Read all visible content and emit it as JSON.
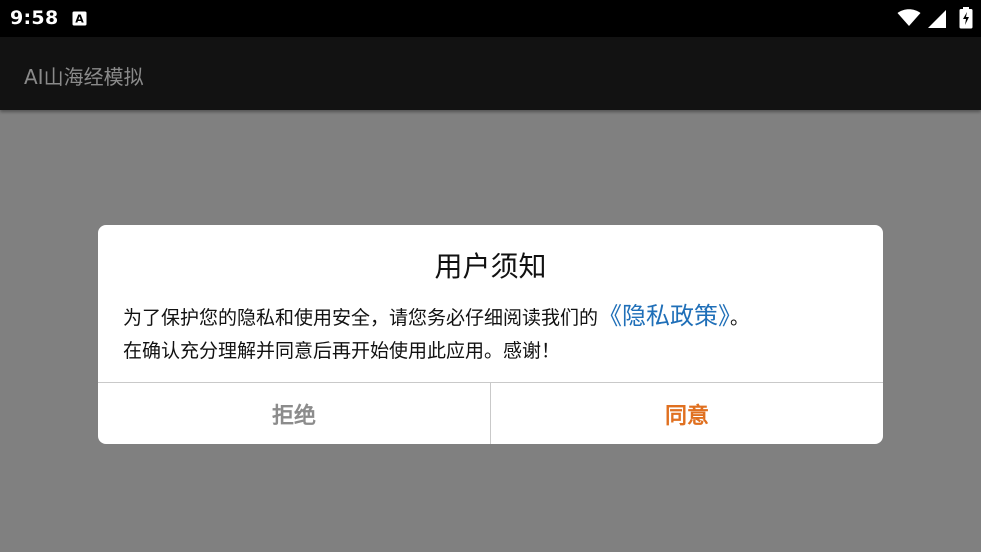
{
  "status_bar": {
    "time": "9:58",
    "app_icon": "A",
    "icons": [
      "wifi-icon",
      "cell-signal-icon",
      "battery-charging-icon"
    ]
  },
  "app_bar": {
    "title": "AI山海经模拟"
  },
  "dialog": {
    "title": "用户须知",
    "body_prefix": "为了保护您的隐私和使用安全，请您务必仔细阅读我们的",
    "policy_link": "《隐私政策》",
    "body_suffix": "。",
    "body_line2": "在确认充分理解并同意后再开始使用此应用。感谢！",
    "reject_label": "拒绝",
    "agree_label": "同意"
  },
  "colors": {
    "link": "#1f6fb8",
    "agree": "#e07020",
    "reject": "#8c8c8c",
    "scrim": "#808080"
  }
}
